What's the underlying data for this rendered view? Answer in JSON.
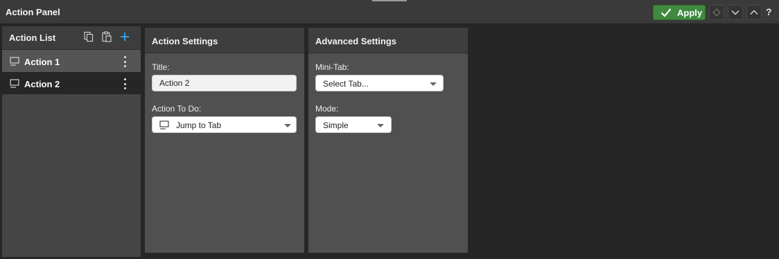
{
  "window": {
    "title": "Action Panel"
  },
  "toolbar": {
    "apply_label": "Apply",
    "help_label": "?",
    "apply_color": "#3f8a3f"
  },
  "sidebar": {
    "header_label": "Action List",
    "icons": [
      "copy-icon",
      "paste-icon",
      "add-icon"
    ],
    "items": [
      {
        "label": "Action 1",
        "icon": "monitor-icon",
        "selected": false
      },
      {
        "label": "Action 2",
        "icon": "monitor-icon",
        "selected": true
      }
    ]
  },
  "action_settings": {
    "header": "Action Settings",
    "title_label": "Title:",
    "title_value": "Action 2",
    "action_label": "Action To Do:",
    "action_value": "Jump to Tab"
  },
  "advanced_settings": {
    "header": "Advanced Settings",
    "minitab_label": "Mini-Tab:",
    "minitab_value": "Select Tab...",
    "mode_label": "Mode:",
    "mode_value": "Simple"
  }
}
